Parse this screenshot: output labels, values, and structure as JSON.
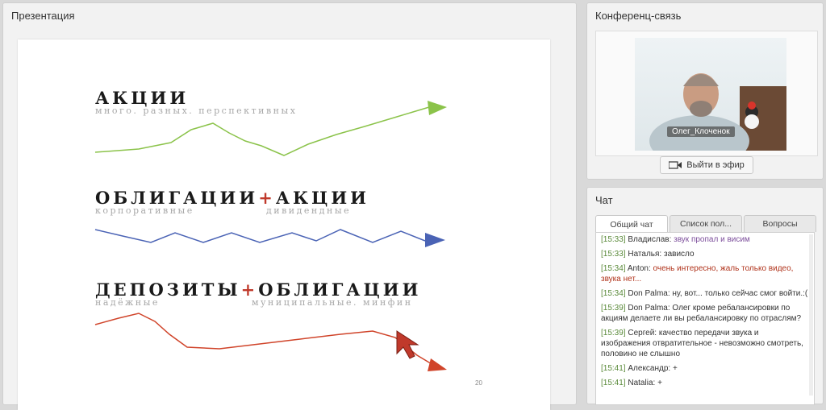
{
  "presentation": {
    "title": "Презентация",
    "slide": {
      "block1": {
        "heading": "АКЦИИ",
        "sub": "много. разных. перспективных"
      },
      "block2": {
        "heading_a": "ОБЛИГАЦИИ",
        "plus": "+",
        "heading_b": "АКЦИИ",
        "sub_a": "корпоративные",
        "sub_b": "дивидендные"
      },
      "block3": {
        "heading_a": "ДЕПОЗИТЫ",
        "plus": "+",
        "heading_b": "ОБЛИГАЦИИ",
        "sub_a": "надёжные",
        "sub_b": "муниципальные. минфин"
      },
      "page_number": "20",
      "colors": {
        "green": "#8bc34a",
        "blue": "#4a63b5",
        "red": "#d0442a"
      }
    }
  },
  "conference": {
    "title": "Конференц-связь",
    "participant_name": "Олег_Клоченок",
    "live_button_label": "Выйти в эфир",
    "live_button_icon": "camera-icon"
  },
  "chat": {
    "title": "Чат",
    "tabs": [
      "Общий чат",
      "Список пол...",
      "Вопросы"
    ],
    "messages": [
      {
        "time": "[15:33]",
        "author": "Владислав:",
        "text": "звук пропал и висим",
        "style": "purple"
      },
      {
        "time": "[15:33]",
        "author": "Наталья:",
        "text": "зависло",
        "style": "plain"
      },
      {
        "time": "[15:34]",
        "author": "Anton:",
        "text": "очень интересно, жаль только видео, звука нет...",
        "style": "red"
      },
      {
        "time": "[15:34]",
        "author": "Don Palma:",
        "text": "ну, вот... только сейчас смог войти.:(",
        "style": "plain"
      },
      {
        "time": "[15:39]",
        "author": "Don Palma:",
        "text": "Олег кроме ребалансировки по акциям делаете ли вы ребалансировку по отраслям?",
        "style": "plain"
      },
      {
        "time": "[15:39]",
        "author": "Сергей:",
        "text": "качество передачи звука и изображения отвратительное - невозможно смотреть, половино не слышно",
        "style": "plain"
      },
      {
        "time": "[15:41]",
        "author": "Александр:",
        "text": "+",
        "style": "plain"
      },
      {
        "time": "[15:41]",
        "author": "Natalia:",
        "text": "+",
        "style": "plain"
      }
    ]
  }
}
